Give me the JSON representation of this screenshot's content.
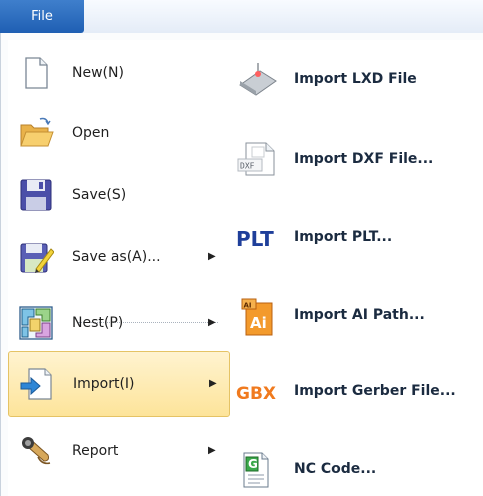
{
  "file_tab": "File",
  "left_menu": [
    {
      "label": "New(N)",
      "icon": "new-document-icon",
      "submenu": false
    },
    {
      "label": "Open",
      "icon": "open-folder-icon",
      "submenu": false
    },
    {
      "label": "Save(S)",
      "icon": "save-disk-icon",
      "submenu": false
    },
    {
      "label": "Save as(A)...",
      "icon": "save-as-icon",
      "submenu": true
    },
    {
      "label": "Nest(P)",
      "icon": "nest-icon",
      "submenu": true
    },
    {
      "label": "Import(I)",
      "icon": "import-icon",
      "submenu": true,
      "active": true
    },
    {
      "label": "Report",
      "icon": "report-icon",
      "submenu": true
    }
  ],
  "right_menu": [
    {
      "label": "Import LXD File",
      "icon": "lxd-file-icon"
    },
    {
      "label": "Import DXF File...",
      "icon": "dxf-file-icon",
      "icon_text": "DXF"
    },
    {
      "label": "Import PLT...",
      "icon": "plt-icon",
      "icon_text": "PLT"
    },
    {
      "label": "Import AI Path...",
      "icon": "ai-file-icon",
      "icon_text": "Ai",
      "icon_badge": "AI"
    },
    {
      "label": "Import Gerber File...",
      "icon": "gbx-icon",
      "icon_text": "GBX"
    },
    {
      "label": "NC Code...",
      "icon": "nc-code-icon",
      "icon_text": "G"
    }
  ],
  "colors": {
    "file_tab": "#1f5fb3",
    "active_item": "#fde49a",
    "plt_blue": "#1f3f9a",
    "gbx_orange": "#f07a1e"
  }
}
